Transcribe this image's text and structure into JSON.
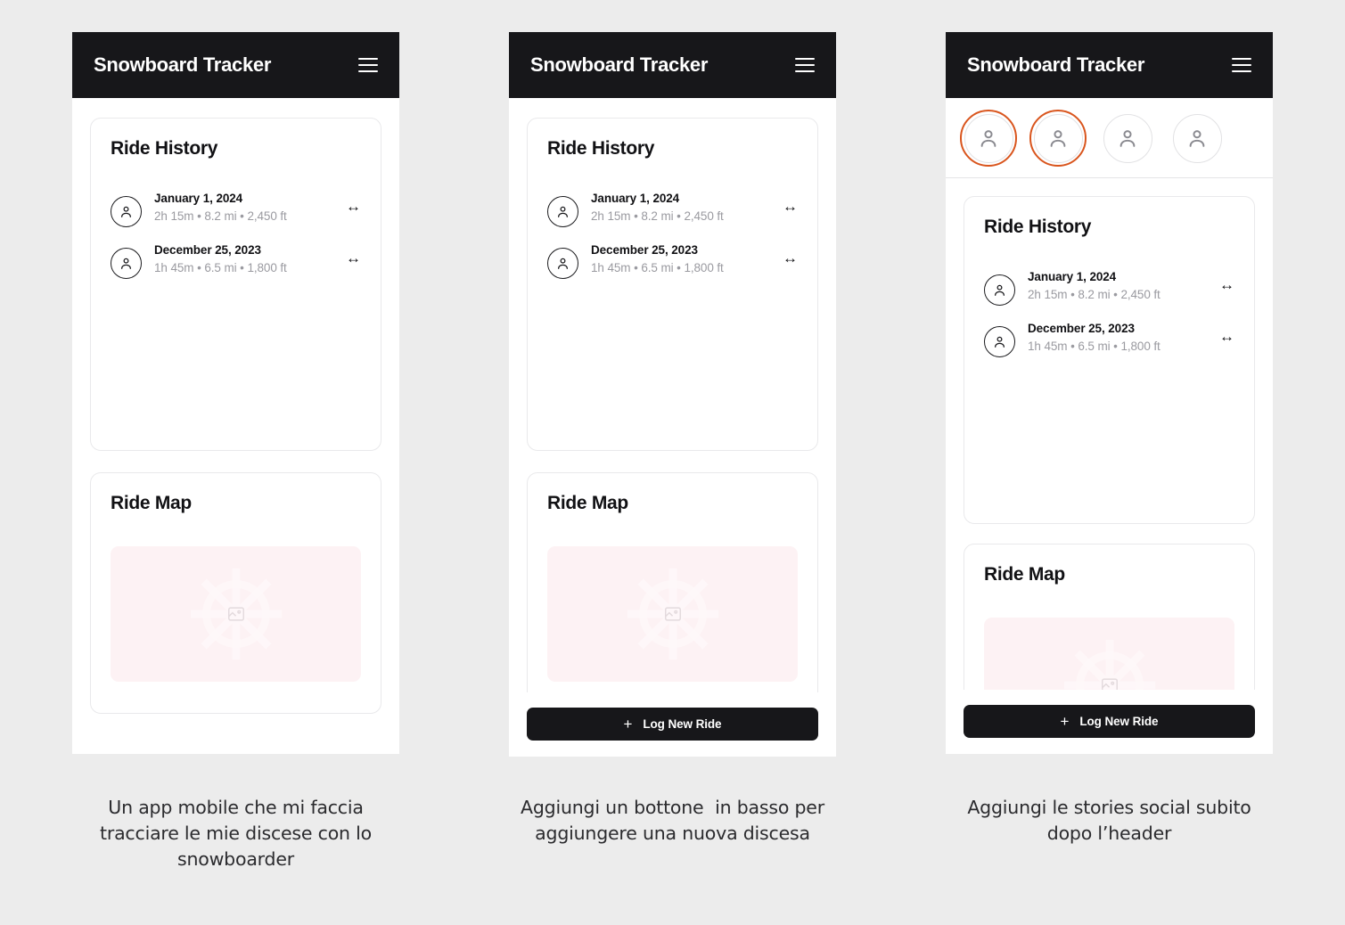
{
  "app": {
    "title": "Snowboard Tracker",
    "menu_icon": "hamburger-menu-icon"
  },
  "colors": {
    "header_bg": "#17171a",
    "page_bg": "#ececec",
    "phone_bg": "#ffffff",
    "story_ring_active": "#d9551d",
    "story_ring_inactive": "#e2e2e4",
    "map_placeholder_bg": "#fdf2f4",
    "muted_text": "#9a9aa0"
  },
  "stories": {
    "items": [
      {
        "name": "story-1",
        "state": "unseen",
        "icon": "user-avatar-icon"
      },
      {
        "name": "story-2",
        "state": "unseen",
        "icon": "user-avatar-icon"
      },
      {
        "name": "story-3",
        "state": "seen",
        "icon": "user-avatar-icon"
      },
      {
        "name": "story-4",
        "state": "seen",
        "icon": "user-avatar-icon"
      }
    ]
  },
  "history": {
    "title": "Ride History",
    "rides": [
      {
        "date": "January 1, 2024",
        "stats": "2h 15m • 8.2 mi • 2,450 ft",
        "arrow": "↔",
        "avatar_icon": "user-avatar-icon"
      },
      {
        "date": "December 25, 2023",
        "stats": "1h 45m • 6.5 mi • 1,800 ft",
        "arrow": "↔",
        "avatar_icon": "user-avatar-icon"
      }
    ]
  },
  "map": {
    "title": "Ride Map",
    "placeholder_icon": "broken-image-icon"
  },
  "log_button": {
    "label": "Log New Ride",
    "icon": "plus-icon"
  },
  "captions": {
    "panel1": "Un app mobile che mi faccia tracciare le mie discese con lo snowboarder",
    "panel2": "Aggiungi un bottone  in basso per aggiungere una nuova discesa",
    "panel3": "Aggiungi le stories social subito dopo l’header"
  }
}
